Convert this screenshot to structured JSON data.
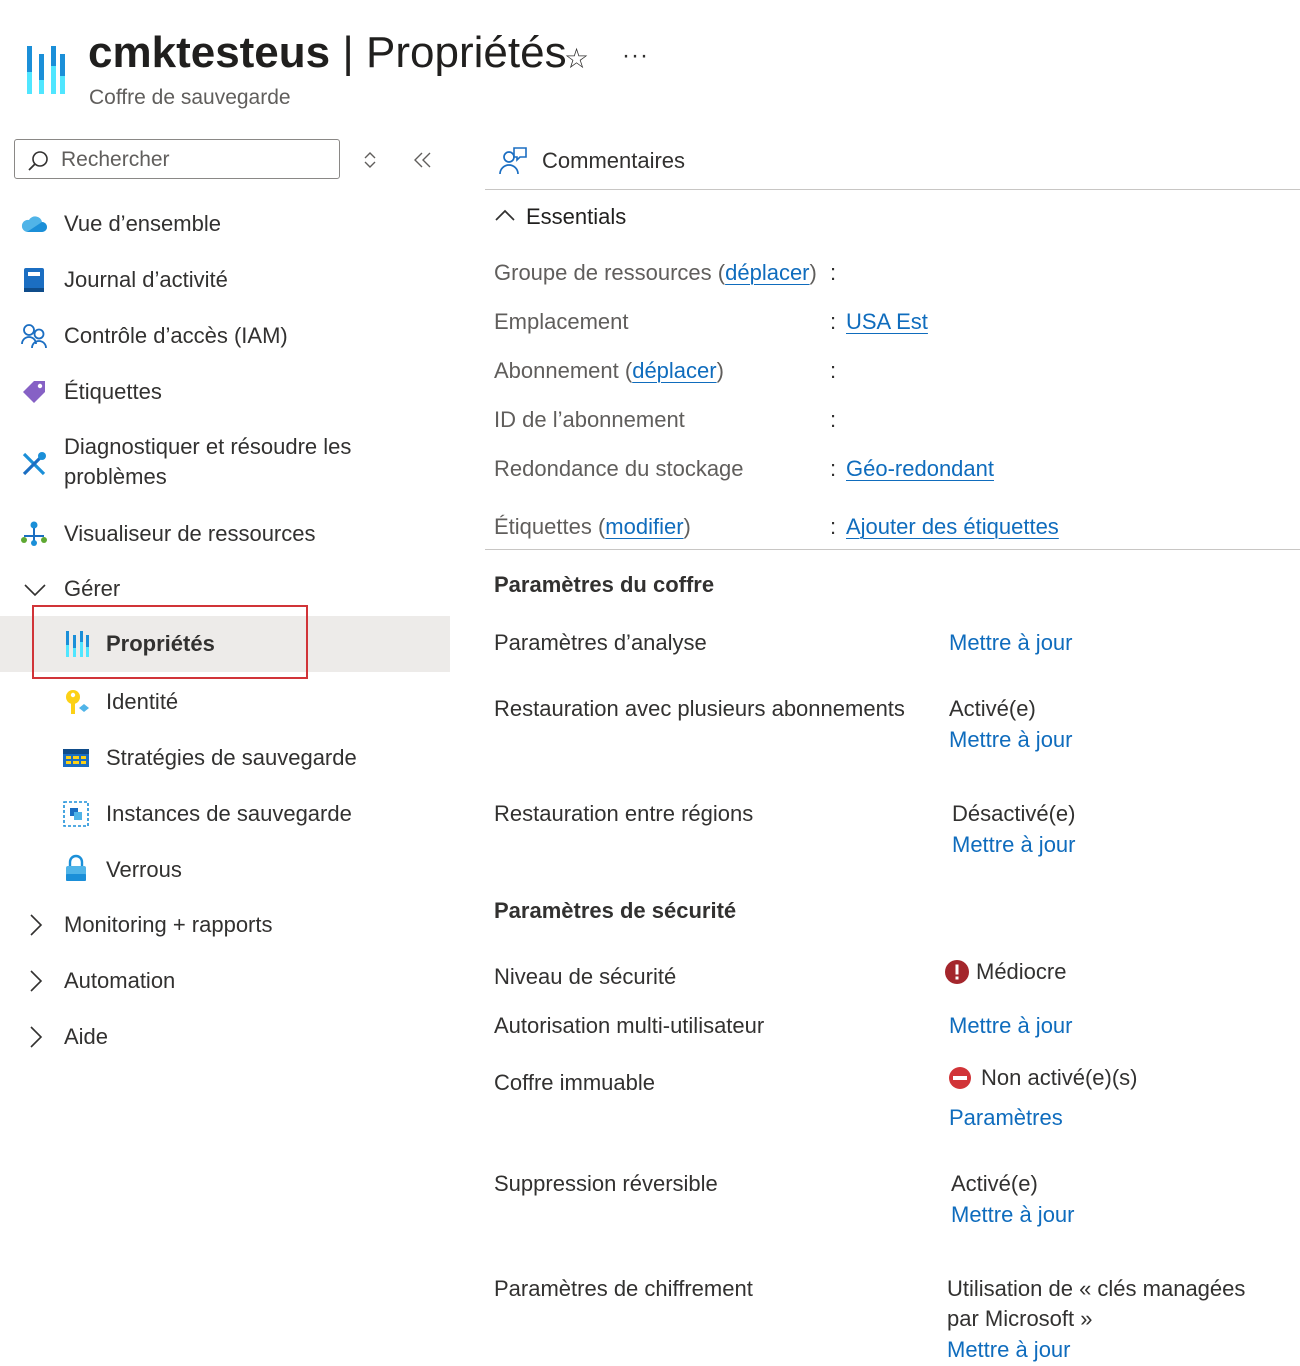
{
  "header": {
    "resource_name": "cmktesteus",
    "separator": " | ",
    "page_name": "Propriétés",
    "subtitle": "Coffre de sauvegarde",
    "favorite_glyph": "☆",
    "more_glyph": "···"
  },
  "sidebar": {
    "search_placeholder": "Rechercher",
    "items": [
      {
        "label": "Vue d’ensemble",
        "icon": "cloud-overview-icon"
      },
      {
        "label": "Journal d’activité",
        "icon": "activity-log-icon"
      },
      {
        "label": "Contrôle d’accès (IAM)",
        "icon": "people-icon"
      },
      {
        "label": "Étiquettes",
        "icon": "tag-icon"
      },
      {
        "label": "Diagnostiquer et résoudre les",
        "label2": "problèmes",
        "icon": "wrench-icon"
      },
      {
        "label": "Visualiseur de ressources",
        "icon": "resource-visualizer-icon"
      }
    ],
    "manage": {
      "label": "Gérer",
      "items": [
        {
          "label": "Propriétés",
          "icon": "properties-icon",
          "selected": true
        },
        {
          "label": "Identité",
          "icon": "identity-key-icon"
        },
        {
          "label": "Stratégies de sauvegarde",
          "icon": "backup-policies-icon"
        },
        {
          "label": "Instances de sauvegarde",
          "icon": "backup-instances-icon"
        },
        {
          "label": "Verrous",
          "icon": "lock-icon"
        }
      ]
    },
    "groups": [
      {
        "label": "Monitoring + rapports"
      },
      {
        "label": "Automation"
      },
      {
        "label": "Aide"
      }
    ]
  },
  "toolbar": {
    "feedback_label": "Commentaires"
  },
  "essentials": {
    "label": "Essentials",
    "rows": [
      {
        "key": "Groupe de ressources (",
        "key_link": "déplacer",
        "key_suffix": ")",
        "value": ""
      },
      {
        "key": "Emplacement",
        "value": "USA Est"
      },
      {
        "key": "Abonnement (",
        "key_link": "déplacer",
        "key_suffix": ")",
        "value": ""
      },
      {
        "key": "ID de l’abonnement",
        "value": ""
      },
      {
        "key": "Redondance du stockage",
        "value": "Géo-redondant"
      },
      {
        "key": "Étiquettes (",
        "key_link": "modifier",
        "key_suffix": ")",
        "value": "Ajouter des étiquettes"
      }
    ],
    "colon": ":"
  },
  "vault_settings": {
    "title": "Paramètres du coffre",
    "analysis": {
      "label": "Paramètres d’analyse",
      "action": "Mettre à jour"
    },
    "cross_sub_restore": {
      "label": "Restauration avec plusieurs abonnements",
      "status": "Activé(e)",
      "action": "Mettre à jour"
    },
    "cross_region_restore": {
      "label": "Restauration entre régions",
      "status": "Désactivé(e)",
      "action": "Mettre à jour"
    }
  },
  "security_settings": {
    "title": "Paramètres de sécurité",
    "security_level": {
      "label": "Niveau de sécurité",
      "status": "Médiocre",
      "icon": "error-icon",
      "color": "#a4262c"
    },
    "mua": {
      "label": "Autorisation multi-utilisateur",
      "action": "Mettre à jour"
    },
    "immutable": {
      "label": "Coffre immuable",
      "status": "Non activé(e)(s)",
      "icon": "blocked-icon",
      "color": "#d13438",
      "action": "Paramètres"
    },
    "soft_delete": {
      "label": "Suppression réversible",
      "status": "Activé(e)",
      "action": "Mettre à jour"
    },
    "encryption": {
      "label": "Paramètres de chiffrement",
      "status_line1": "Utilisation de « clés managées",
      "status_line2": "par Microsoft »",
      "action": "Mettre à jour"
    }
  },
  "colors": {
    "link": "#0f6cbd",
    "selected_bg": "#edebe9",
    "highlight_border": "#d13438",
    "azure_blue": "#0078d4"
  }
}
